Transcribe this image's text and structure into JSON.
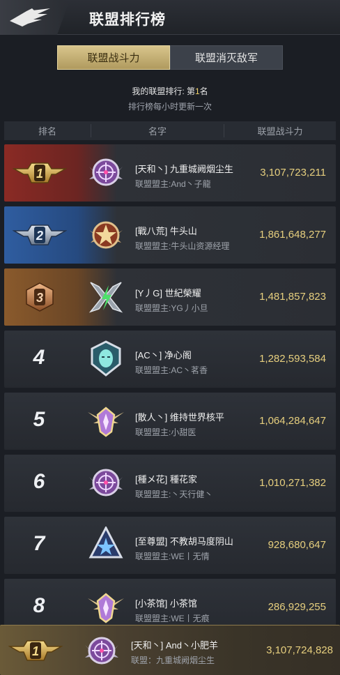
{
  "header": {
    "title": "联盟排行榜",
    "back_icon": "eagle-back-icon"
  },
  "tabs": [
    {
      "label": "联盟战斗力",
      "active": true
    },
    {
      "label": "联盟消灭敌军",
      "active": false
    }
  ],
  "rank_info": {
    "prefix": "我的联盟排行: 第",
    "rank": "1",
    "suffix": "名",
    "update_note": "排行榜每小时更新一次"
  },
  "table": {
    "columns": [
      "排名",
      "名字",
      "联盟战斗力"
    ],
    "rows": [
      {
        "rank": "1",
        "name": "[天和丶] 九重城阙烟尘生",
        "leader": "联盟盟主:And丶子龍",
        "power": "3,107,723,211",
        "emblem": "purple-crosshair-emblem-icon"
      },
      {
        "rank": "2",
        "name": "[戰八荒] 牛头山",
        "leader": "联盟盟主:牛头山资源经理",
        "power": "1,861,648,277",
        "emblem": "bronze-star-emblem-icon"
      },
      {
        "rank": "3",
        "name": "[Y丿G] 世紀榮耀",
        "leader": "联盟盟主:YG丿小旦",
        "power": "1,481,857,823",
        "emblem": "green-lightning-emblem-icon"
      },
      {
        "rank": "4",
        "name": "[AC丶] 净心阁",
        "leader": "联盟盟主:AC丶茗香",
        "power": "1,282,593,584",
        "emblem": "teal-mask-emblem-icon"
      },
      {
        "rank": "5",
        "name": "[散人丶] 维持世界核平",
        "leader": "联盟盟主:小甜医",
        "power": "1,064,284,647",
        "emblem": "gold-winged-emblem-icon"
      },
      {
        "rank": "6",
        "name": "[種メ花] 種花家",
        "leader": "联盟盟主:丶天行健丶",
        "power": "1,010,271,382",
        "emblem": "purple-crosshair-emblem-icon"
      },
      {
        "rank": "7",
        "name": "[至尊盟] 不教胡马度阴山",
        "leader": "联盟盟主:WE丨无情",
        "power": "928,680,647",
        "emblem": "blue-star-emblem-icon"
      },
      {
        "rank": "8",
        "name": "[小茶馆] 小茶馆",
        "leader": "联盟盟主:WE丨无痕",
        "power": "286,929,255",
        "emblem": "gold-winged-emblem-icon"
      }
    ]
  },
  "my_alliance": {
    "rank": "1",
    "name": "[天和丶] And丶小肥羊",
    "leader": "联盟：九重城阙烟尘生",
    "power": "3,107,724,828",
    "emblem": "purple-crosshair-emblem-icon"
  },
  "colors": {
    "gold_text": "#e7cf7e",
    "tab_active": "#c9b57a",
    "background": "#1b1e24"
  }
}
